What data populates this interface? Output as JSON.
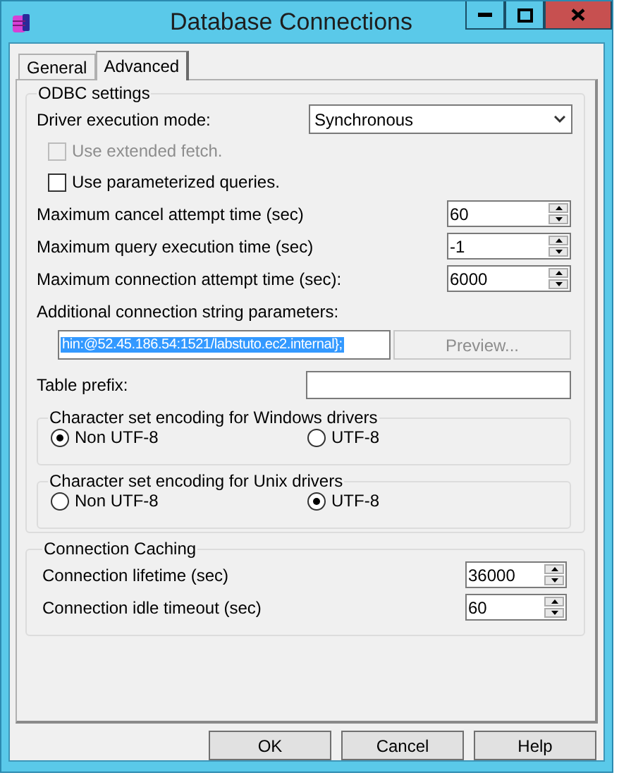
{
  "window": {
    "title": "Database Connections"
  },
  "tabs": [
    {
      "label": "General",
      "selected": false
    },
    {
      "label": "Advanced",
      "selected": true
    }
  ],
  "odbc_settings": {
    "title": "ODBC settings",
    "driver_execution_mode": {
      "label": "Driver execution mode:",
      "value": "Synchronous"
    },
    "options": [
      {
        "label": "Use extended fetch.",
        "checked": false,
        "disabled": true
      },
      {
        "label": "Use parameterized queries.",
        "checked": false,
        "disabled": false
      }
    ],
    "spinners": [
      {
        "label": "Maximum cancel attempt time (sec)",
        "value": "60"
      },
      {
        "label": "Maximum query execution time (sec)",
        "value": "-1"
      },
      {
        "label": "Maximum connection attempt time (sec):",
        "value": "6000"
      }
    ],
    "connection_string": {
      "label": "Additional connection string parameters:",
      "value": "hin:@52.45.186.54:1521/labstuto.ec2.internal};",
      "selected": true
    },
    "preview_button": {
      "label": "Preview...",
      "disabled": true
    },
    "table_prefix": {
      "label": "Table prefix:"
    },
    "encodings": [
      {
        "title": "Character set encoding for Windows drivers",
        "options": [
          {
            "label": "Non UTF-8",
            "selected": true
          },
          {
            "label": "UTF-8",
            "selected": false
          }
        ]
      },
      {
        "title": "Character set encoding for Unix drivers",
        "options": [
          {
            "label": "Non UTF-8",
            "selected": false
          },
          {
            "label": "UTF-8",
            "selected": true
          }
        ]
      }
    ]
  },
  "connection_caching": {
    "title": "Connection Caching",
    "spinners": [
      {
        "label": "Connection lifetime (sec)",
        "value": "36000"
      },
      {
        "label": "Connection idle timeout (sec)",
        "value": "60"
      }
    ]
  },
  "buttons": [
    "OK",
    "Cancel",
    "Help"
  ]
}
